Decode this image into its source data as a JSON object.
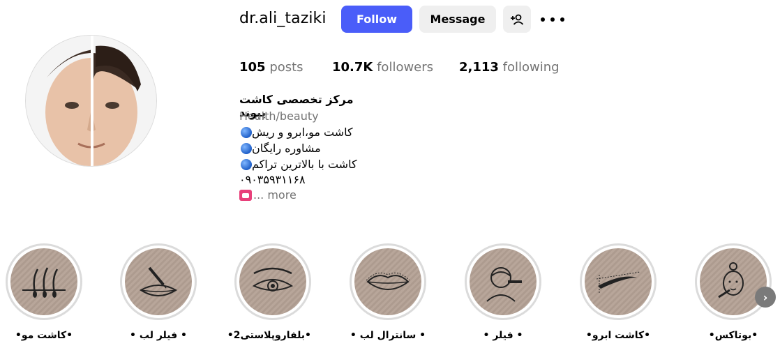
{
  "profile": {
    "username": "dr.ali_taziki",
    "follow_label": "Follow",
    "message_label": "Message",
    "adduser_icon": "add-user-icon",
    "more_icon": "more-options-icon"
  },
  "stats": {
    "posts_count": "105",
    "posts_label": "posts",
    "followers_count": "10.7K",
    "followers_label": "followers",
    "following_count": "2,113",
    "following_label": "following"
  },
  "bio": {
    "name": "مرکز تخصصی کاشت پیوند",
    "category": "Health/beauty",
    "lines": [
      "کاشت مو،ابرو و ریش",
      "مشاوره رایگان",
      "کاشت با بالاترین تراکم",
      "۰۹۰۳۵۹۳۱۱۶۸"
    ],
    "bullet_icon": "blue-circle-icon",
    "phone_icon": "telephone-icon",
    "more_text": "... more"
  },
  "highlights": [
    {
      "label": "•کاشت مو•",
      "icon": "hair-follicle-icon"
    },
    {
      "label": "• فیلر لب •",
      "icon": "lip-filler-syringe-icon"
    },
    {
      "label": "•بلفاروپلاستی2•",
      "icon": "eye-icon"
    },
    {
      "label": "• سانترال لب •",
      "icon": "lips-icon"
    },
    {
      "label": "• فیلر •",
      "icon": "face-injection-icon"
    },
    {
      "label": "•کاشت ابرو•",
      "icon": "eyebrow-icon"
    },
    {
      "label": "•بوتاکس•",
      "icon": "botox-face-icon"
    }
  ],
  "colors": {
    "accent": "#4a5df9",
    "highlight_bg": "#b8a69a",
    "muted_text": "#737373"
  }
}
